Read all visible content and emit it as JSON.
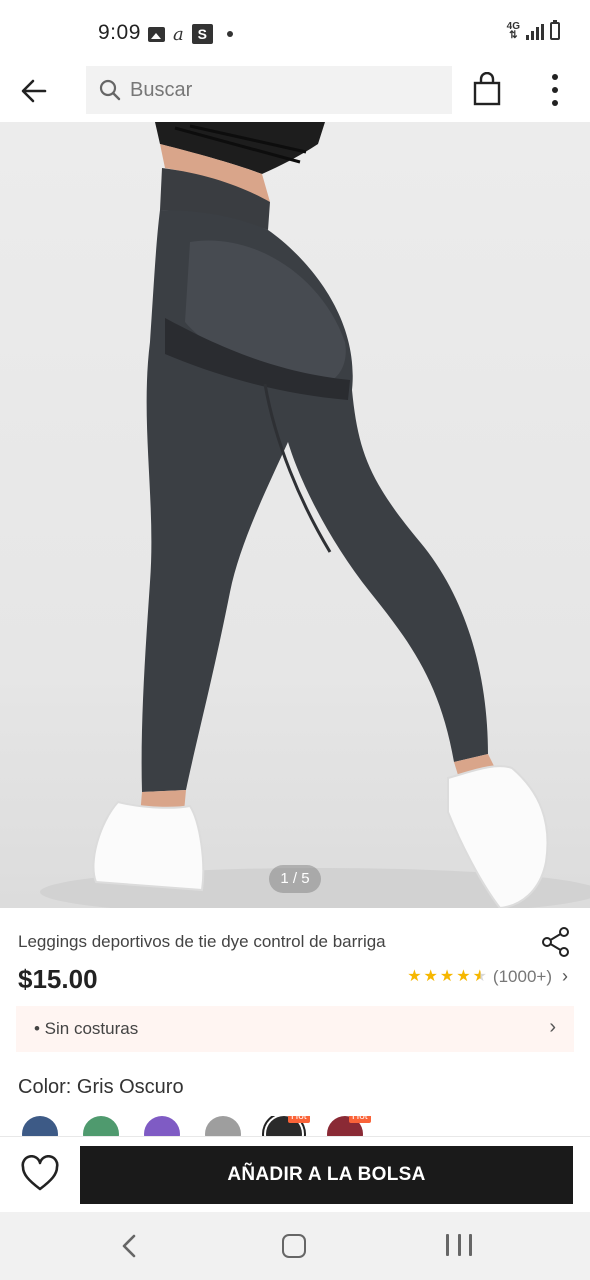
{
  "status_bar": {
    "time": "9:09",
    "left_icons": [
      "gallery-icon",
      "a-icon",
      "s-icon",
      "dot-icon"
    ],
    "right_icons": [
      "4g-icon",
      "signal-icon",
      "battery-icon"
    ],
    "network": "4G"
  },
  "app_bar": {
    "search_placeholder": "Buscar",
    "icons": [
      "back-arrow-icon",
      "search-icon",
      "shopping-bag-icon",
      "more-vertical-icon"
    ]
  },
  "product": {
    "image_page": "1 / 5",
    "title": "Leggings deportivos de tie dye control de barriga",
    "price": "$15.00",
    "rating_stars": 4.5,
    "rating_count": "(1000+)",
    "promo_label": "• Sin costuras",
    "color_label": "Color: Gris Oscuro",
    "swatches": [
      {
        "color": "#3d5a86",
        "hot": false
      },
      {
        "color": "#4f9a6e",
        "hot": false
      },
      {
        "color": "#7f5bc4",
        "hot": false
      },
      {
        "color": "#9e9e9e",
        "hot": false
      },
      {
        "color": "#2a2a2a",
        "hot": true,
        "badge": "Hot"
      },
      {
        "color": "#8a2a35",
        "hot": true,
        "badge": "Hot"
      }
    ]
  },
  "actions": {
    "add_to_bag": "AÑADIR A LA BOLSA"
  },
  "colors": {
    "accent_star": "#f6b700",
    "button_bg": "#1a1a1a",
    "promo_bg": "#fff5f2",
    "hot_badge": "#fa6338"
  }
}
